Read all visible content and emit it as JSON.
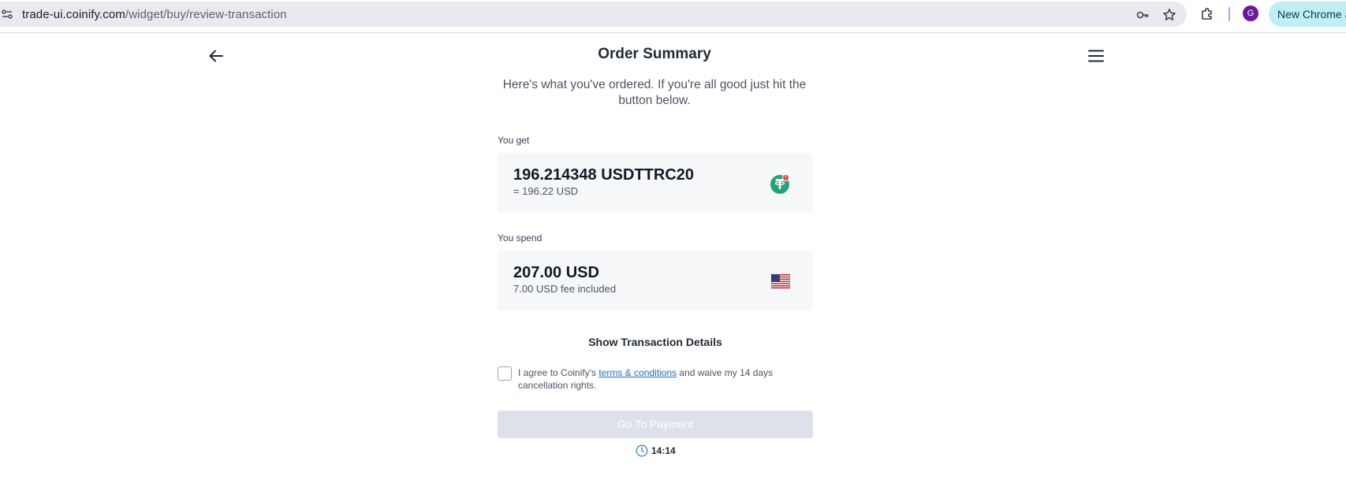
{
  "browser": {
    "url_host": "trade-ui.coinify.com",
    "url_path": "/widget/buy/review-transaction",
    "profile_initial": "G",
    "new_chrome_label": "New Chrome a"
  },
  "header": {
    "title": "Order Summary"
  },
  "intro": "Here's what you've ordered. If you're all good just hit the button below.",
  "you_get": {
    "label": "You get",
    "amount": "196.214348 USDTTRC20",
    "equivalent": "= 196.22 USD",
    "icon": "tether-icon"
  },
  "you_spend": {
    "label": "You spend",
    "amount": "207.00 USD",
    "fee_note": "7.00 USD fee included",
    "icon": "us-flag-icon"
  },
  "details_toggle": "Show Transaction Details",
  "consent": {
    "prefix": "I agree to Coinify's ",
    "link": "terms & conditions",
    "suffix": " and waive my 14 days cancellation rights.",
    "checked": false
  },
  "payment_button": {
    "label": "Go To Payment",
    "enabled": false
  },
  "timer": "14:14",
  "colors": {
    "accent_link": "#1d6fb8",
    "tether_green": "#26a17b",
    "disabled_button": "#dde1ea"
  }
}
